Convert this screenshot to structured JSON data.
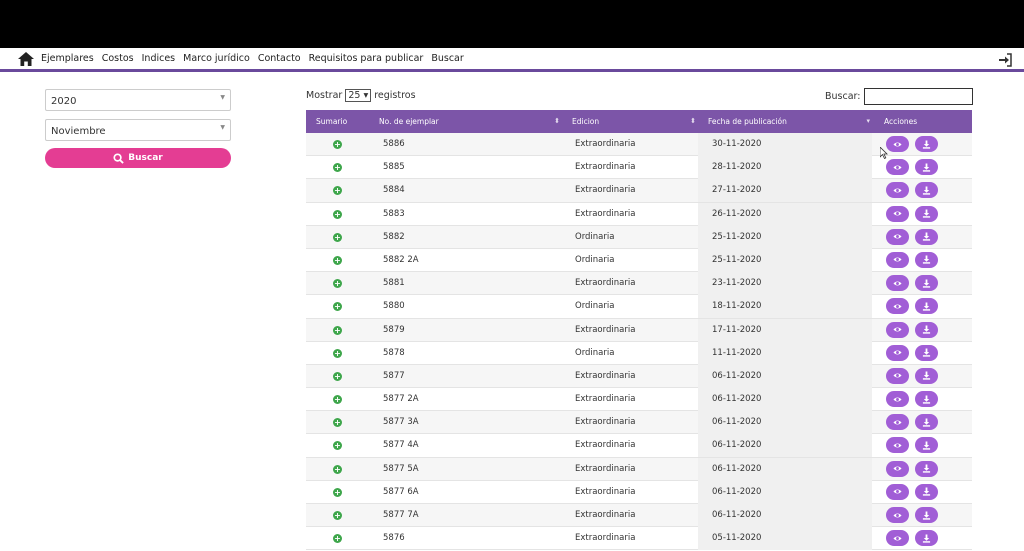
{
  "nav": {
    "items": [
      "Ejemplares",
      "Costos",
      "Indices",
      "Marco jurídico",
      "Contacto",
      "Requisitos para publicar",
      "Buscar"
    ]
  },
  "filters": {
    "year": "2020",
    "month": "Noviembre",
    "search_button": "Buscar"
  },
  "table": {
    "length_prefix": "Mostrar",
    "length_value": "25",
    "length_suffix": "registros",
    "search_label": "Buscar:",
    "headers": [
      "Sumario",
      "No. de ejemplar",
      "Edicion",
      "Fecha de publicación",
      "Acciones"
    ],
    "rows": [
      {
        "numero": "5886",
        "edicion": "Extraordinaria",
        "fecha": "30-11-2020"
      },
      {
        "numero": "5885",
        "edicion": "Extraordinaria",
        "fecha": "28-11-2020"
      },
      {
        "numero": "5884",
        "edicion": "Extraordinaria",
        "fecha": "27-11-2020"
      },
      {
        "numero": "5883",
        "edicion": "Extraordinaria",
        "fecha": "26-11-2020"
      },
      {
        "numero": "5882",
        "edicion": "Ordinaria",
        "fecha": "25-11-2020"
      },
      {
        "numero": "5882 2A",
        "edicion": "Ordinaria",
        "fecha": "25-11-2020"
      },
      {
        "numero": "5881",
        "edicion": "Extraordinaria",
        "fecha": "23-11-2020"
      },
      {
        "numero": "5880",
        "edicion": "Ordinaria",
        "fecha": "18-11-2020"
      },
      {
        "numero": "5879",
        "edicion": "Extraordinaria",
        "fecha": "17-11-2020"
      },
      {
        "numero": "5878",
        "edicion": "Ordinaria",
        "fecha": "11-11-2020"
      },
      {
        "numero": "5877",
        "edicion": "Extraordinaria",
        "fecha": "06-11-2020"
      },
      {
        "numero": "5877 2A",
        "edicion": "Extraordinaria",
        "fecha": "06-11-2020"
      },
      {
        "numero": "5877 3A",
        "edicion": "Extraordinaria",
        "fecha": "06-11-2020"
      },
      {
        "numero": "5877 4A",
        "edicion": "Extraordinaria",
        "fecha": "06-11-2020"
      },
      {
        "numero": "5877 5A",
        "edicion": "Extraordinaria",
        "fecha": "06-11-2020"
      },
      {
        "numero": "5877 6A",
        "edicion": "Extraordinaria",
        "fecha": "06-11-2020"
      },
      {
        "numero": "5877 7A",
        "edicion": "Extraordinaria",
        "fecha": "06-11-2020"
      },
      {
        "numero": "5876",
        "edicion": "Extraordinaria",
        "fecha": "05-11-2020"
      }
    ]
  },
  "colors": {
    "header_bg": "#7c55a8",
    "button_pink": "#e43d93",
    "action_purple": "#a15ed6",
    "sumario_green": "#3ea64b"
  }
}
